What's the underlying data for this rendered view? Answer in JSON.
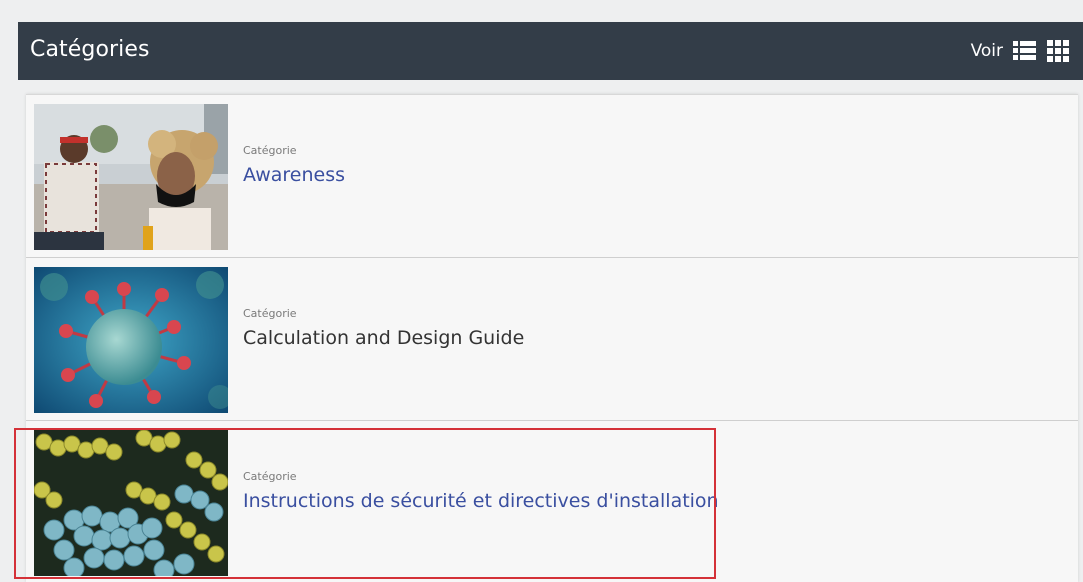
{
  "header": {
    "title": "Catégories",
    "view_label": "Voir",
    "icons": [
      "list-view-icon",
      "grid-view-icon"
    ]
  },
  "categories": [
    {
      "type_label": "Catégorie",
      "title": "Awareness",
      "thumb": "people-wearing-masks-photo"
    },
    {
      "type_label": "Catégorie",
      "title": "Calculation and Design Guide",
      "thumb": "virus-illustration"
    },
    {
      "type_label": "Catégorie",
      "title": "Instructions de sécurité et directives d'installation",
      "thumb": "bacteria-illustration"
    }
  ],
  "colors": {
    "header_bg": "#333d48",
    "link": "#3a4fa0",
    "highlight": "#d43138"
  }
}
